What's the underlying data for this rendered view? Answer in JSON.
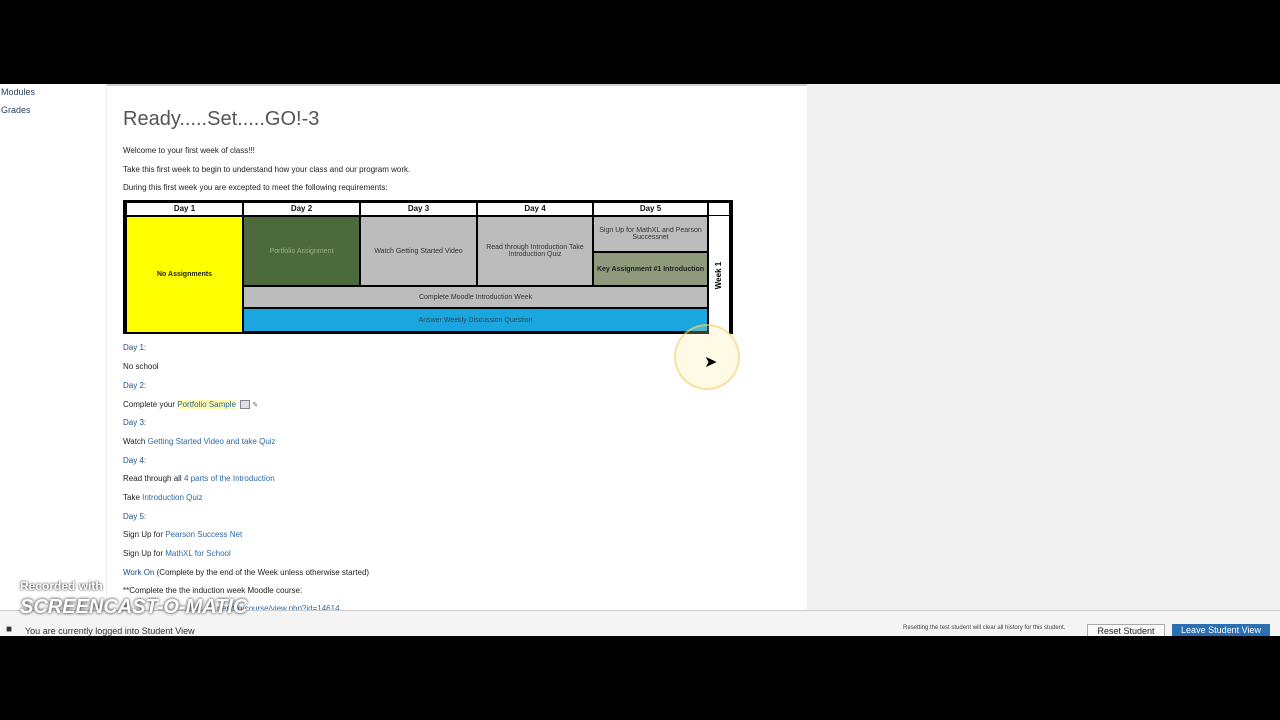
{
  "nav": {
    "items": [
      "Modules",
      "Grades"
    ]
  },
  "page": {
    "title": "Ready.....Set.....GO!-3",
    "intro": [
      "Welcome to your first week of class!!!",
      "Take this first week to begin to understand how your class and our program work.",
      "During this first week you are excepted to meet the following requirements:"
    ]
  },
  "schedule": {
    "headers": [
      "Day 1",
      "Day 2",
      "Day 3",
      "Day 4",
      "Day 5"
    ],
    "day1": "No Assignments",
    "day2": "Portfolio Assignment",
    "day3": "Watch Getting Started Video",
    "day4": "Read through Introduction Take Introduction Quiz",
    "day5a": "Sign Up for MathXL and Pearson Successnet",
    "day5b": "Key Assignment #1 Introduction",
    "row2": "Complete Moodle Introduction Week",
    "row3": "Answer Weekly Discussion Question",
    "week": "Week 1",
    "colors": {
      "day1": "#ffff00",
      "day2": "#4d6a3c",
      "gray": "#bcbcbc",
      "day5b": "#8f9a7d",
      "discussion": "#1aa7e0"
    }
  },
  "details": {
    "d1_label": "Day 1:",
    "d1_text": "No school",
    "d2_label": "Day 2:",
    "d2_prefix": "Complete your ",
    "d2_link": "Portfolio Sample",
    "d3_label": "Day 3:",
    "d3_prefix": "Watch ",
    "d3_link": "Getting Started Video and take Quiz",
    "d4_label": "Day 4:",
    "d4_prefix": "Read through all ",
    "d4_link": "4 parts of the Introduction",
    "d4b_prefix": "Take ",
    "d4b_link": "Introduction Quiz",
    "d5_label": "Day 5:",
    "d5_prefix": "Sign Up for ",
    "d5_link": "Pearson Success Net",
    "d5b_prefix": "Sign Up for ",
    "d5b_link": "MathXL for School",
    "work_label": "Work On",
    "work_text": " (Complete by the end of the Week unless otherwise started)",
    "note": "**Complete the the induction week Moodle course:",
    "url": "rter.org/course/view.php?id=14614"
  },
  "statusbar": {
    "logged_in": "You are currently logged into Student View",
    "warning": "Resetting the test student will clear all history for this student.",
    "reset_label": "Reset Student",
    "leave_label": "Leave Student View"
  },
  "watermark": {
    "line1": "Recorded with",
    "line2": "SCREENCAST-O-MATIC"
  }
}
